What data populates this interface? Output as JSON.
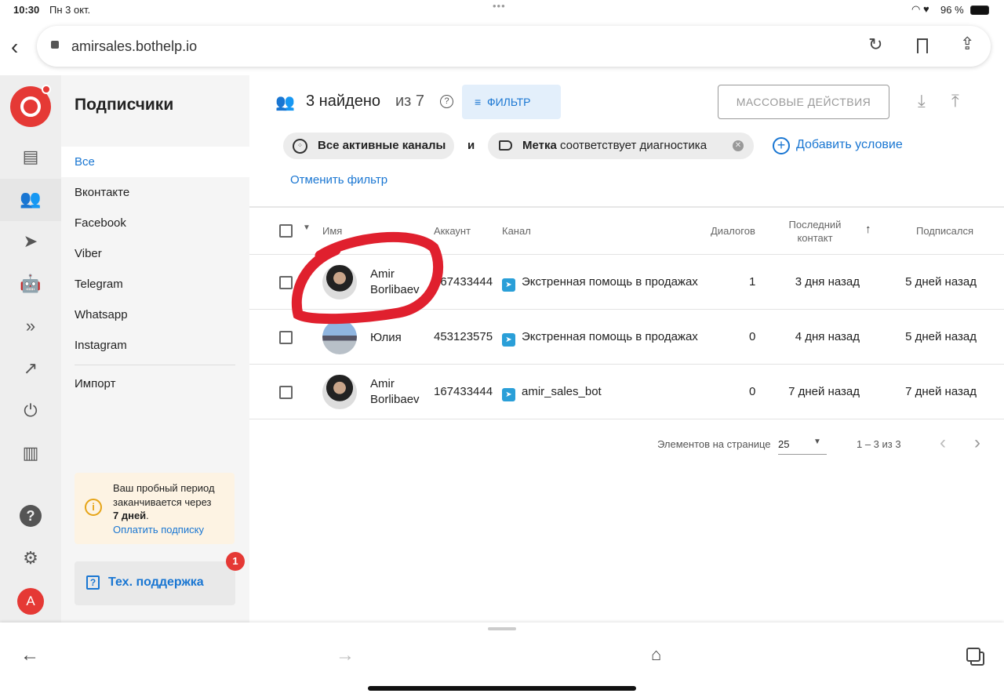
{
  "status_bar": {
    "time": "10:30",
    "date": "Пн 3 окт.",
    "battery": "96 %"
  },
  "browser": {
    "url": "amirsales.bothelp.io"
  },
  "sidebar": {
    "title": "Подписчики",
    "items": [
      {
        "label": "Все"
      },
      {
        "label": "Вконтакте"
      },
      {
        "label": "Facebook"
      },
      {
        "label": "Viber"
      },
      {
        "label": "Telegram"
      },
      {
        "label": "Whatsapp"
      },
      {
        "label": "Instagram"
      },
      {
        "label": "Импорт"
      }
    ],
    "trial": {
      "line1": "Ваш пробный период заканчивается через",
      "days": "7 дней",
      "dot": ".",
      "link": "Оплатить подписку"
    },
    "support": {
      "label": "Тех. поддержка",
      "badge": "1"
    },
    "avatar_letter": "A"
  },
  "header": {
    "found": "3 найдено",
    "of": "из 7",
    "filter_button": "ФИЛЬТР",
    "bulk_button": "МАССОВЫЕ ДЕЙСТВИЯ"
  },
  "filters": {
    "chip1": "Все активные каналы",
    "and": "и",
    "chip2_bold": "Метка",
    "chip2_rest": "соответствует диагностика",
    "add": "Добавить условие",
    "cancel": "Отменить фильтр"
  },
  "table": {
    "headers": {
      "name": "Имя",
      "account": "Аккаунт",
      "channel": "Канал",
      "dialogs": "Диалогов",
      "last1": "Последний",
      "last2": "контакт",
      "sort": "↑",
      "subscribed": "Подписался"
    },
    "rows": [
      {
        "name1": "Amir",
        "name2": "Borlibaev",
        "account": "167433444",
        "channel": "Экстренная помощь в продажах",
        "dialogs": "1",
        "last": "3 дня назад",
        "subscribed": "5 дней назад"
      },
      {
        "name1": "Юлия",
        "name2": "",
        "account": "453123575",
        "channel": "Экстренная помощь в продажах",
        "dialogs": "0",
        "last": "4 дня назад",
        "subscribed": "5 дней назад"
      },
      {
        "name1": "Amir",
        "name2": "Borlibaev",
        "account": "167433444",
        "channel": "amir_sales_bot",
        "dialogs": "0",
        "last": "7 дней назад",
        "subscribed": "7 дней назад"
      }
    ]
  },
  "pagination": {
    "per_page_label": "Элементов на странице",
    "per_page": "25",
    "range": "1 – 3 из 3"
  },
  "colors": {
    "accent": "#1976d2",
    "brand": "#e53935",
    "annotation": "#e0202e"
  }
}
